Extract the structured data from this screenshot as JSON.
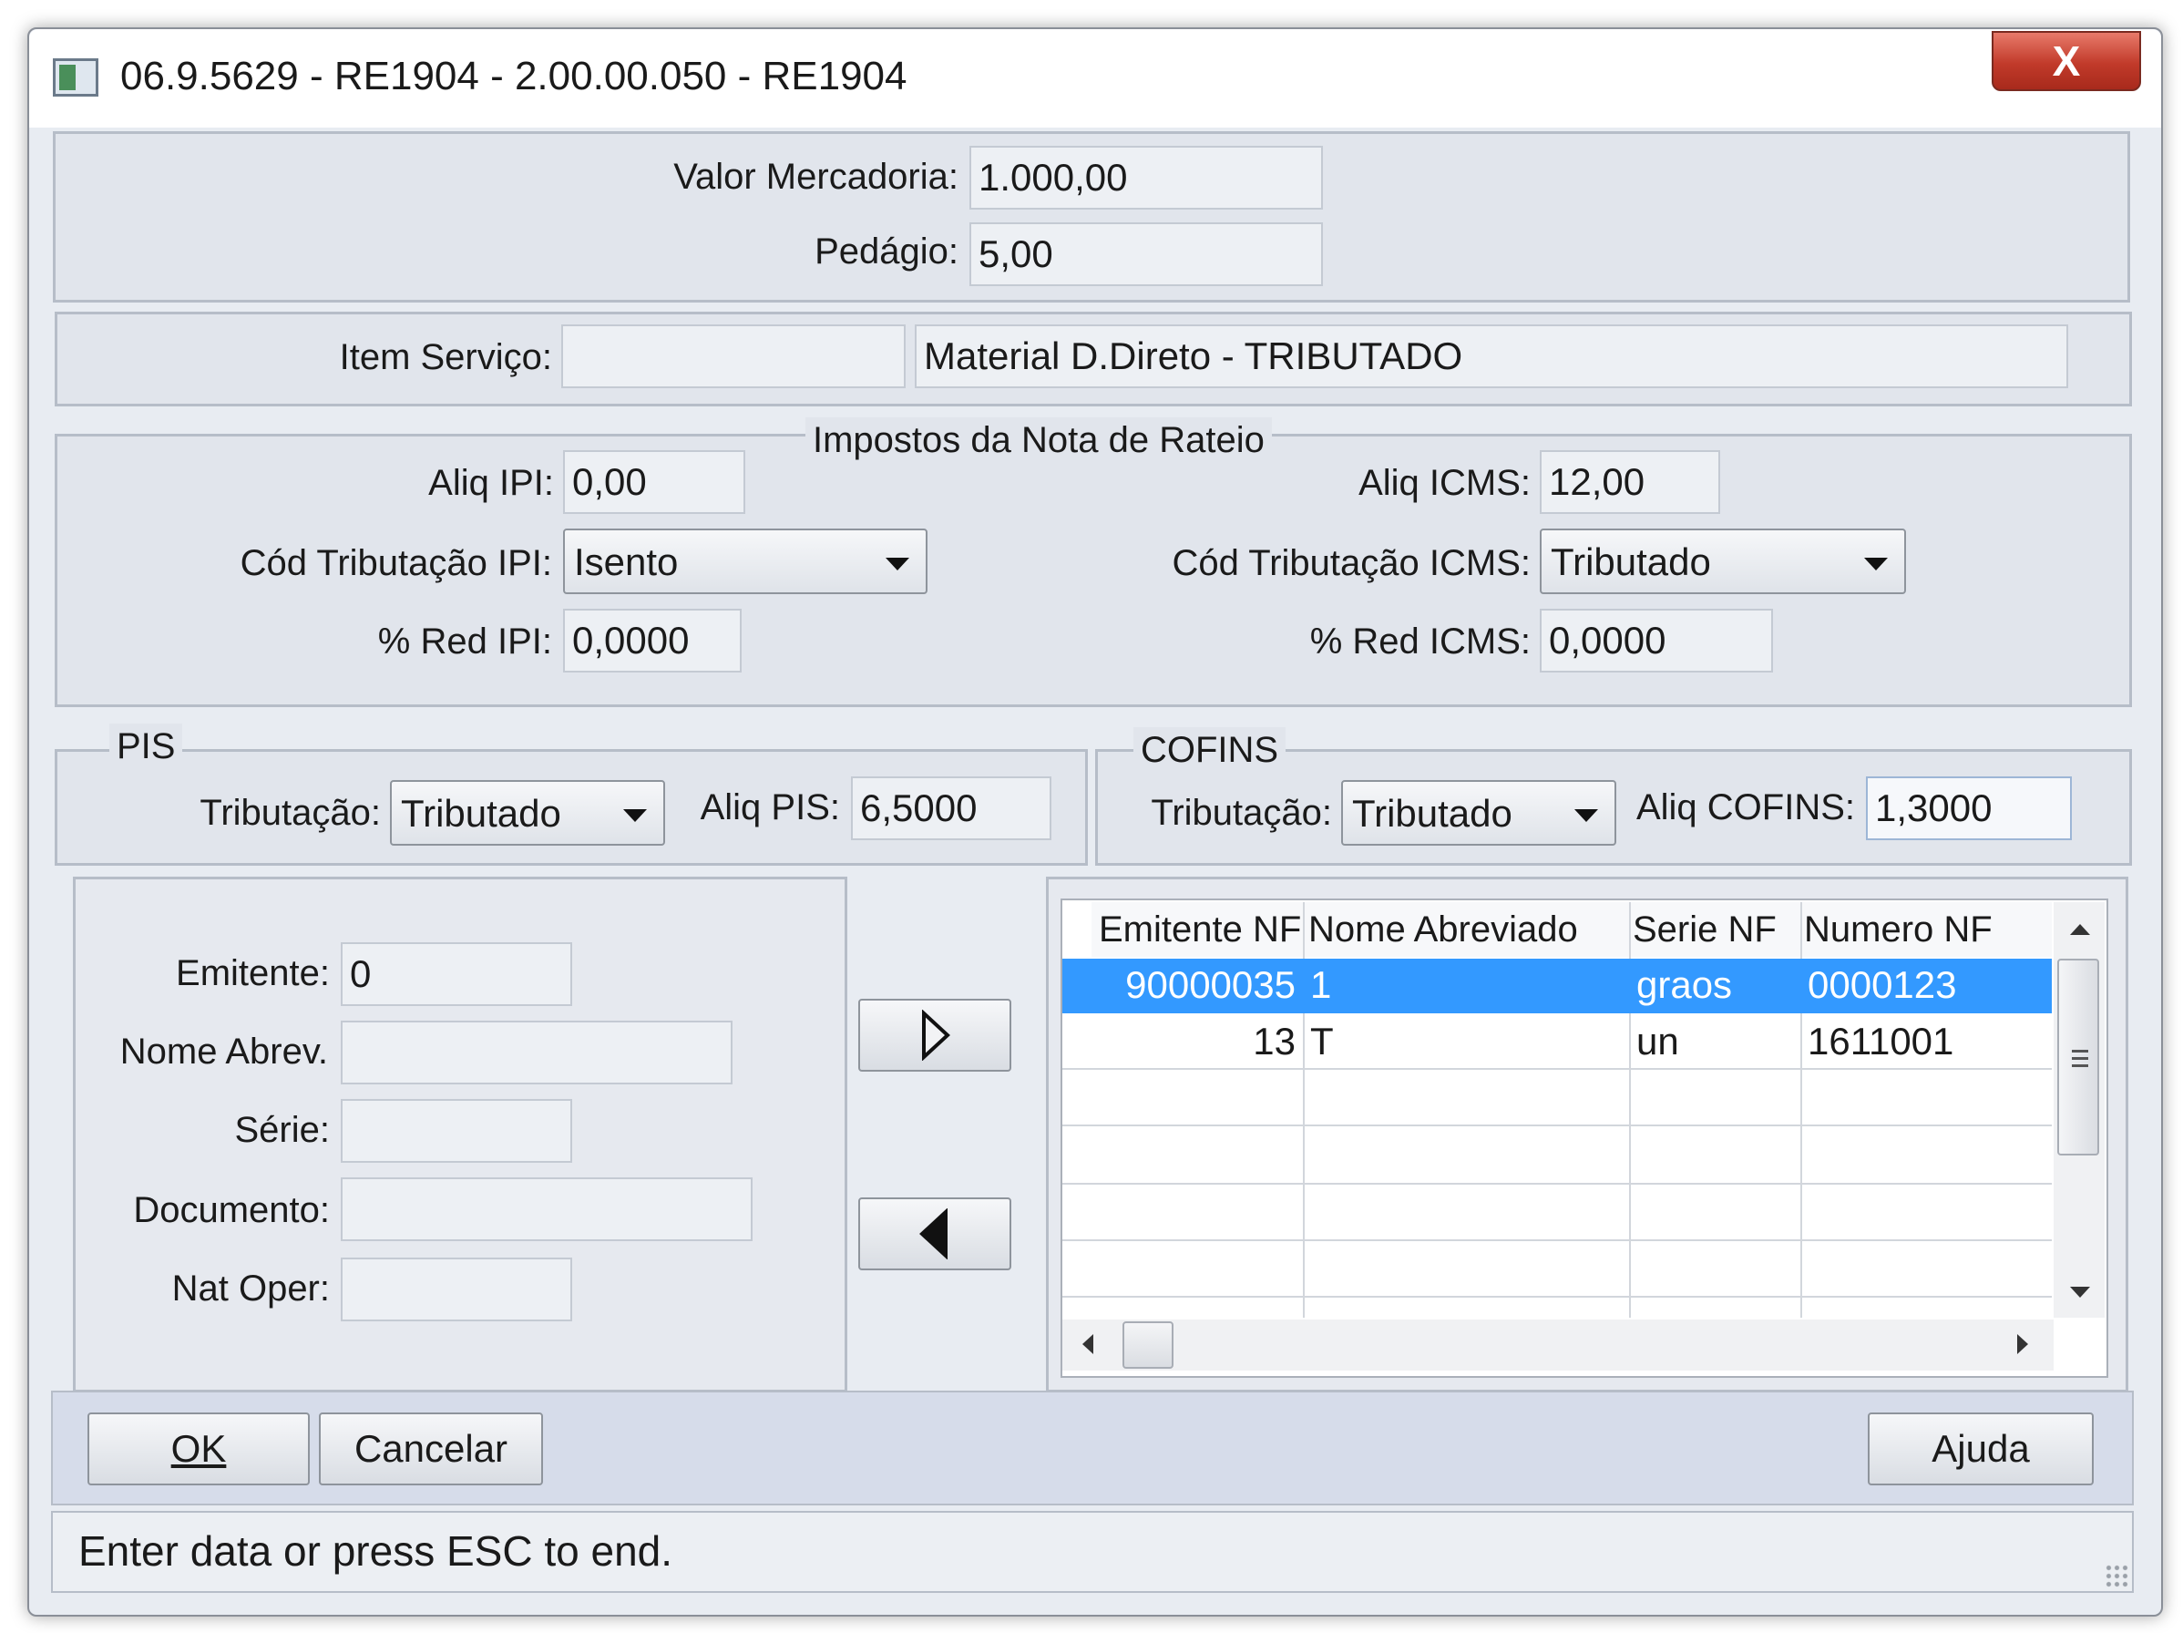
{
  "window": {
    "title": "06.9.5629 - RE1904 - 2.00.00.050 - RE1904",
    "close_label": "X"
  },
  "top": {
    "valor_mercadoria": {
      "label": "Valor Mercadoria:",
      "value": "1.000,00"
    },
    "pedagio": {
      "label": "Pedágio:",
      "value": "5,00"
    }
  },
  "item_servico": {
    "label": "Item Serviço:",
    "code": "",
    "description": "Material D.Direto - TRIBUTADO"
  },
  "impostos": {
    "title": "Impostos da Nota de Rateio",
    "aliq_ipi": {
      "label": "Aliq IPI:",
      "value": "0,00"
    },
    "cod_trib_ipi": {
      "label": "Cód Tributação IPI:",
      "value": "Isento"
    },
    "red_ipi": {
      "label": "% Red IPI:",
      "value": "0,0000"
    },
    "aliq_icms": {
      "label": "Aliq ICMS:",
      "value": "12,00"
    },
    "cod_trib_icms": {
      "label": "Cód Tributação ICMS:",
      "value": "Tributado"
    },
    "red_icms": {
      "label": "% Red ICMS:",
      "value": "0,0000"
    }
  },
  "pis": {
    "title": "PIS",
    "tributacao": {
      "label": "Tributação:",
      "value": "Tributado"
    },
    "aliq": {
      "label": "Aliq PIS:",
      "value": "6,5000"
    }
  },
  "cofins": {
    "title": "COFINS",
    "tributacao": {
      "label": "Tributação:",
      "value": "Tributado"
    },
    "aliq": {
      "label": "Aliq COFINS:",
      "value": "1,3000"
    }
  },
  "left_form": {
    "emitente": {
      "label": "Emitente:",
      "value": "0"
    },
    "nome_abrev": {
      "label": "Nome Abrev.",
      "value": ""
    },
    "serie": {
      "label": "Série:",
      "value": ""
    },
    "documento": {
      "label": "Documento:",
      "value": ""
    },
    "nat_oper": {
      "label": "Nat Oper:",
      "value": ""
    }
  },
  "grid": {
    "columns": [
      "Emitente NF",
      "Nome Abreviado",
      "Serie NF",
      "Numero NF"
    ],
    "rows": [
      [
        "90000035",
        "1",
        "graos",
        "0000123"
      ],
      [
        "13",
        "T",
        "un",
        "1611001"
      ]
    ],
    "selected_row": 0
  },
  "buttons": {
    "ok": "OK",
    "cancelar": "Cancelar",
    "ajuda": "Ajuda"
  },
  "status": "Enter data or press ESC to end.",
  "colors": {
    "selection": "#3399ff",
    "window_bg": "#e8ecf2",
    "close_button": "#c13a2a"
  },
  "icons": {
    "move_right": "triangle-right-icon",
    "move_left": "triangle-left-icon",
    "dropdown": "chevron-down-icon"
  }
}
